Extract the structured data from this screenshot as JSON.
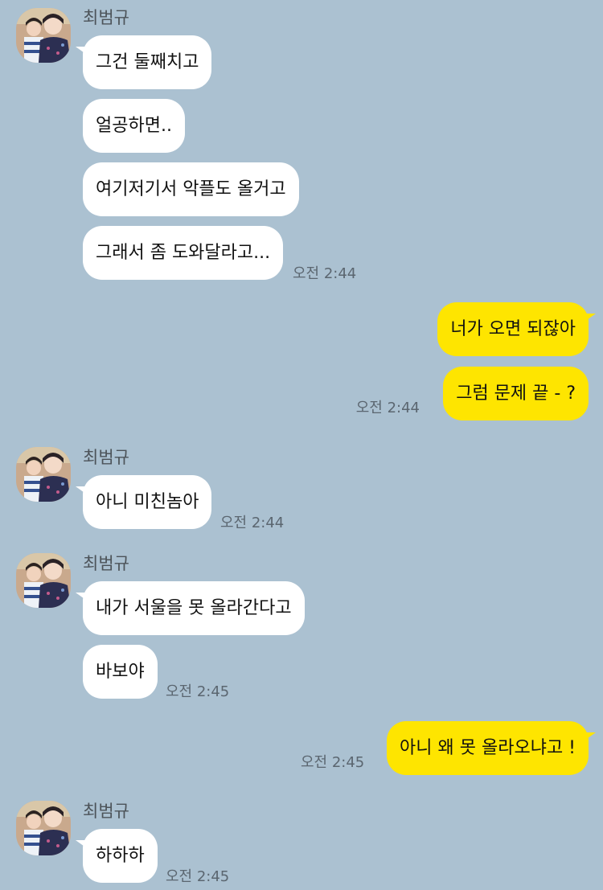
{
  "sender": {
    "name": "최범규"
  },
  "colors": {
    "background": "#abc1d1",
    "incoming": "#ffffff",
    "outgoing": "#fee500"
  },
  "groups": [
    {
      "direction": "in",
      "messages": [
        "그건 둘째치고",
        "얼공하면..",
        "여기저기서 악플도 올거고",
        "그래서 좀 도와달라고..."
      ],
      "time": "오전 2:44"
    },
    {
      "direction": "out",
      "messages": [
        "너가 오면 되잖아",
        "그럼 문제 끝 - ?"
      ],
      "time": "오전 2:44"
    },
    {
      "direction": "in",
      "messages": [
        "아니 미친놈아"
      ],
      "time": "오전 2:44"
    },
    {
      "direction": "in",
      "messages": [
        "내가 서울을 못 올라간다고",
        "바보야"
      ],
      "time": "오전 2:45"
    },
    {
      "direction": "out",
      "messages": [
        "아니 왜 못 올라오냐고 !"
      ],
      "time": "오전 2:45"
    },
    {
      "direction": "in",
      "messages": [
        "하하하"
      ],
      "time": "오전 2:45"
    }
  ]
}
